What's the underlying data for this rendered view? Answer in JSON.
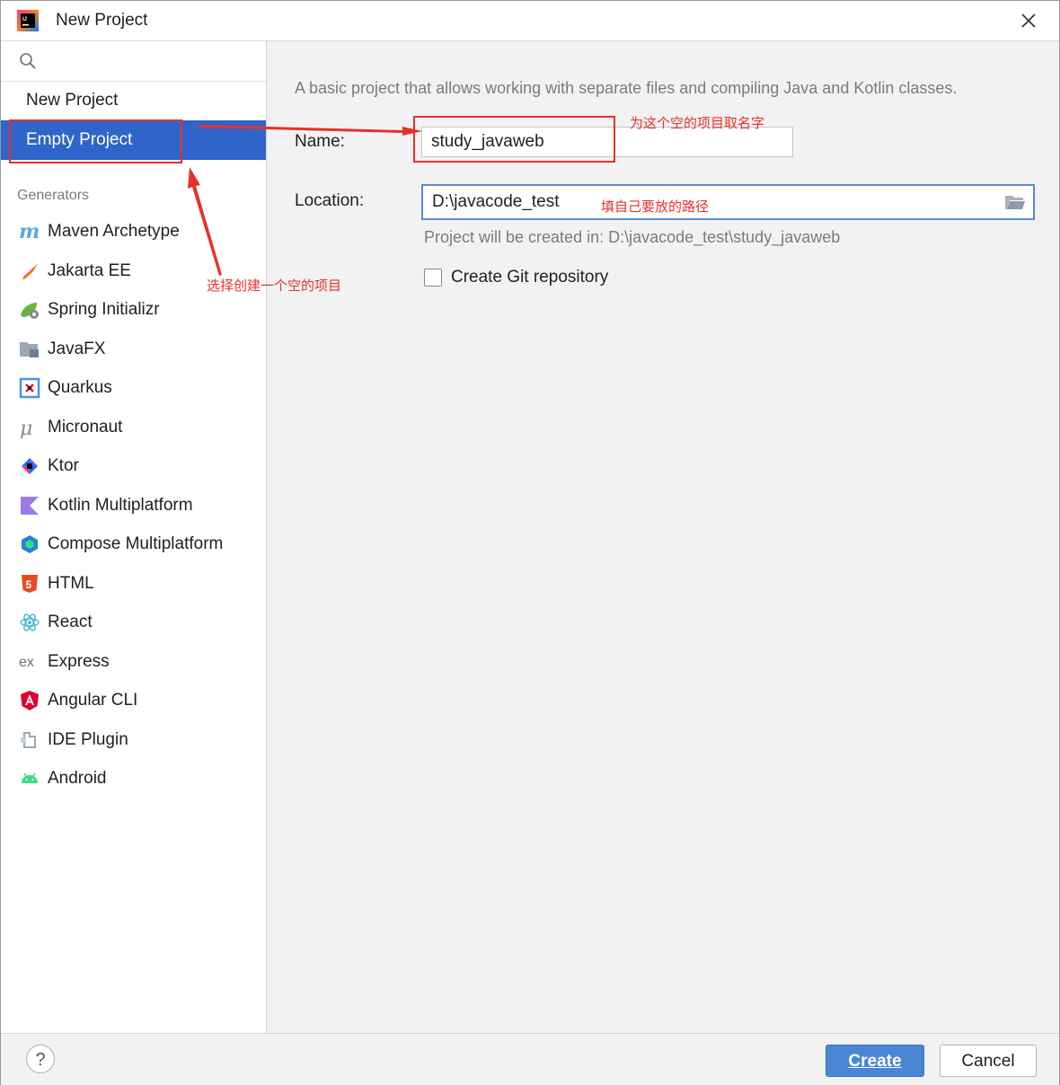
{
  "window": {
    "title": "New Project",
    "app_icon": "intellij-icon"
  },
  "sidebar": {
    "search_placeholder": "",
    "top_items": [
      {
        "label": "New Project",
        "selected": false
      },
      {
        "label": "Empty Project",
        "selected": true
      }
    ],
    "section_label": "Generators",
    "generators": [
      {
        "label": "Maven Archetype",
        "icon": "maven-icon"
      },
      {
        "label": "Jakarta EE",
        "icon": "jakarta-icon"
      },
      {
        "label": "Spring Initializr",
        "icon": "spring-icon"
      },
      {
        "label": "JavaFX",
        "icon": "javafx-icon"
      },
      {
        "label": "Quarkus",
        "icon": "quarkus-icon"
      },
      {
        "label": "Micronaut",
        "icon": "micronaut-icon"
      },
      {
        "label": "Ktor",
        "icon": "ktor-icon"
      },
      {
        "label": "Kotlin Multiplatform",
        "icon": "kotlin-icon"
      },
      {
        "label": "Compose Multiplatform",
        "icon": "compose-icon"
      },
      {
        "label": "HTML",
        "icon": "html5-icon"
      },
      {
        "label": "React",
        "icon": "react-icon"
      },
      {
        "label": "Express",
        "icon": "express-icon"
      },
      {
        "label": "Angular CLI",
        "icon": "angular-icon"
      },
      {
        "label": "IDE Plugin",
        "icon": "plugin-icon"
      },
      {
        "label": "Android",
        "icon": "android-icon"
      }
    ]
  },
  "main": {
    "description": "A basic project that allows working with separate files and compiling Java and Kotlin classes.",
    "name_label": "Name:",
    "name_value": "study_javaweb",
    "location_label": "Location:",
    "location_value": "D:\\javacode_test",
    "created_in_hint": "Project will be created in: D:\\javacode_test\\study_javaweb",
    "git_checkbox_label": "Create Git repository",
    "git_checkbox_checked": false
  },
  "footer": {
    "help_label": "?",
    "create_label": "Create",
    "cancel_label": "Cancel"
  },
  "annotations": {
    "name_note": "为这个空的项目取名字",
    "location_note": "填自己要放的路径",
    "select_note": "选择创建一个空的项目"
  },
  "colors": {
    "accent": "#2f65ca",
    "annotation": "#e8302a",
    "create_button": "#4a86d4"
  }
}
